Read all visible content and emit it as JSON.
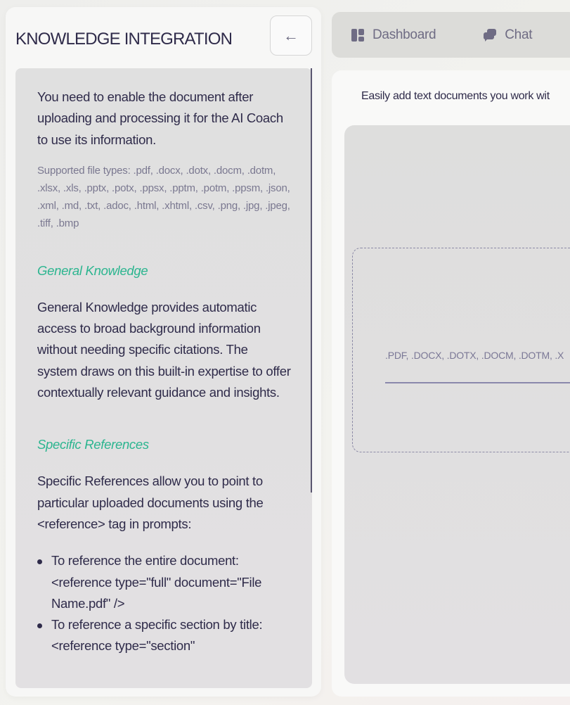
{
  "sidebar": {
    "title": "KNOWLEDGE INTEGRATION",
    "back_icon": "arrow-left-icon",
    "intro": "You need to enable the document after uploading and processing it for the AI Coach to use its information.",
    "supported": "Supported file types: .pdf, .docx, .dotx, .docm, .dotm, .xlsx, .xls, .pptx, .potx, .ppsx, .pptm, .potm, .ppsm, .json, .xml, .md, .txt, .adoc, .html, .xhtml, .csv, .png, .jpg, .jpeg, .tiff, .bmp",
    "general_heading": "General Knowledge",
    "general_text": "General Knowledge provides automatic access to broad background information without needing specific citations. The system draws on this built-in expertise to offer contextually relevant guidance and insights.",
    "specific_heading": "Specific References",
    "specific_text": "Specific References allow you to point to particular uploaded documents using the <reference> tag in prompts:",
    "bullets": [
      "To reference the entire document: <reference type=\"full\" document=\"File Name.pdf\" />",
      "To reference a specific section by title: <reference type=\"section\""
    ]
  },
  "nav": {
    "items": [
      {
        "label": "Dashboard",
        "icon": "dashboard-icon"
      },
      {
        "label": "Chat",
        "icon": "chat-icon"
      }
    ]
  },
  "main": {
    "subtitle": "Easily add text documents you work wit",
    "dropzone_types": ".PDF, .DOCX, .DOTX, .DOCM, .DOTM, .X"
  }
}
